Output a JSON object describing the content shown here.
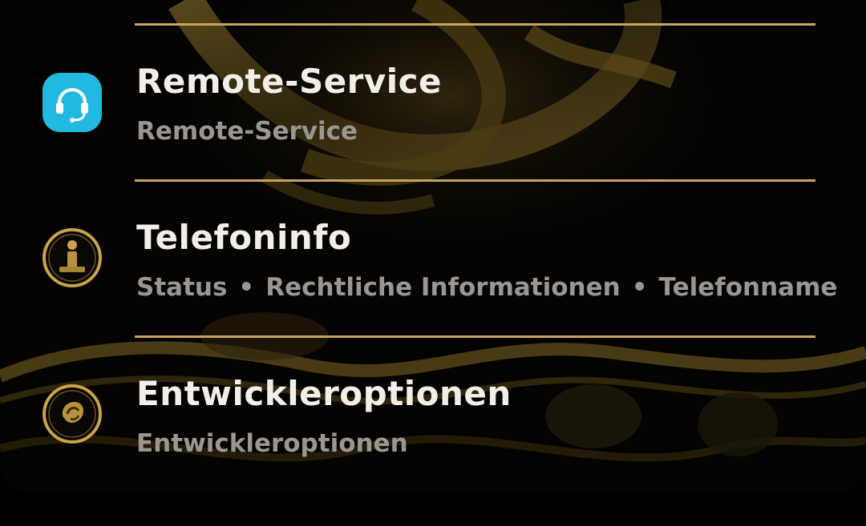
{
  "colors": {
    "divider": "#c9a45c",
    "title": "#f2efe8",
    "subtitle": "#9a9792",
    "remote_icon_bg": "#22b9e0",
    "gold": "#c9a24a"
  },
  "settings_items": [
    {
      "title": "Remote-Service",
      "subtitle": "Remote-Service",
      "icon": "headset-icon"
    },
    {
      "title": "Telefoninfo",
      "subtitle_parts": [
        "Status",
        "Rechtliche Informationen",
        "Telefonname"
      ],
      "separator": "•",
      "icon": "info-icon"
    },
    {
      "title": "Entwickleroptionen",
      "subtitle": "Entwickleroptionen",
      "icon": "developer-options-icon"
    }
  ]
}
